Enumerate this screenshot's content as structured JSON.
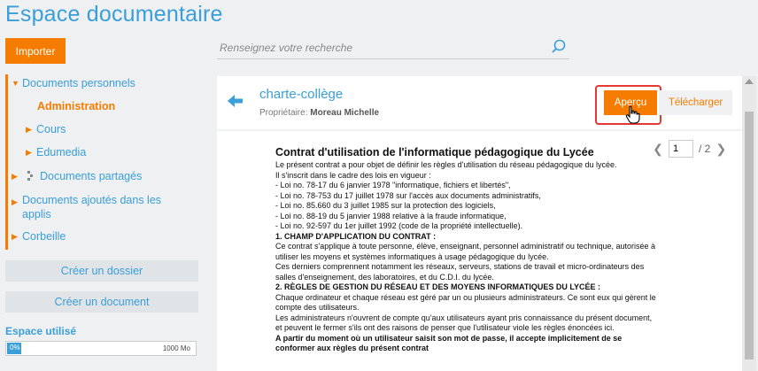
{
  "header": {
    "app_title": "Espace documentaire",
    "import_label": "Importer"
  },
  "search": {
    "placeholder": "Renseignez votre recherche"
  },
  "sidebar": {
    "items": [
      {
        "label": "Documents personnels"
      },
      {
        "label": "Administration"
      },
      {
        "label": "Cours"
      },
      {
        "label": "Edumedia"
      },
      {
        "label": "Documents partagés"
      },
      {
        "label": "Documents ajoutés dans les applis"
      },
      {
        "label": "Corbeille"
      }
    ],
    "create_folder": "Créer un dossier",
    "create_document": "Créer un document",
    "space_label": "Espace utilisé",
    "space_percent": "0%",
    "space_fraction": 0.03,
    "space_total": "1000 Mo"
  },
  "document": {
    "title": "charte-collège",
    "owner_label": "Propriétaire:",
    "owner_name": "Moreau Michelle",
    "preview_label": "Aperçu",
    "download_label": "Télécharger",
    "current_page": "1",
    "total_pages": "/ 2",
    "heading": "Contrat d'utilisation de l'informatique pédagogique du Lycée",
    "lines": [
      "Le présent contrat a pour objet de définir les règles d'utilisation du réseau pédagogique du lycée.",
      "Il s'inscrit dans le cadre des lois en vigueur :",
      "- Loi no. 78-17 du 6 janvier 1978 \"informatique, fichiers et libertés\",",
      "- Loi no. 78-753 du 17 juillet 1978 sur l'accès aux documents administratifs,",
      "- Loi no. 85.660 du 3 juillet 1985 sur la protection des logiciels,",
      "- Loi no. 88-19 du 5 janvier 1988 relative à la fraude informatique,",
      "- Loi no. 92-597 du 1er juillet 1992 (code de la propriété intellectuelle).",
      "1. CHAMP D'APPLICATION DU CONTRAT :",
      "Ce contrat s'applique à toute personne, élève, enseignant, personnel administratif ou technique, autorisée à",
      "utiliser les moyens et systèmes informatiques à usage pédagogique du lycée.",
      "Ces derniers comprennent notamment les réseaux, serveurs, stations de travail et micro-ordinateurs des",
      "salles d'enseignement, des laboratoires, et du C.D.I. du lycée.",
      "2. RÈGLES DE GESTION DU RÉSEAU ET DES MOYENS INFORMATIQUES DU LYCÉE :",
      "Chaque ordinateur et chaque réseau est géré par un ou plusieurs administrateurs. Ce sont eux qui gèrent le",
      "compte des utilisateurs.",
      "Les administrateurs n'ouvrent de compte qu'aux utilisateurs ayant pris connaissance du présent document,",
      "et peuvent le fermer s'ils ont des raisons de penser que l'utilisateur viole les règles énoncées ici.",
      "A partir du moment où un utilisateur saisit son mot de passe, il accepte implicitement de se",
      "conformer aux règles du présent contrat"
    ]
  },
  "colors": {
    "accent_blue": "#3a9ed9",
    "accent_orange": "#f57c00",
    "highlight_red": "#e53935"
  }
}
